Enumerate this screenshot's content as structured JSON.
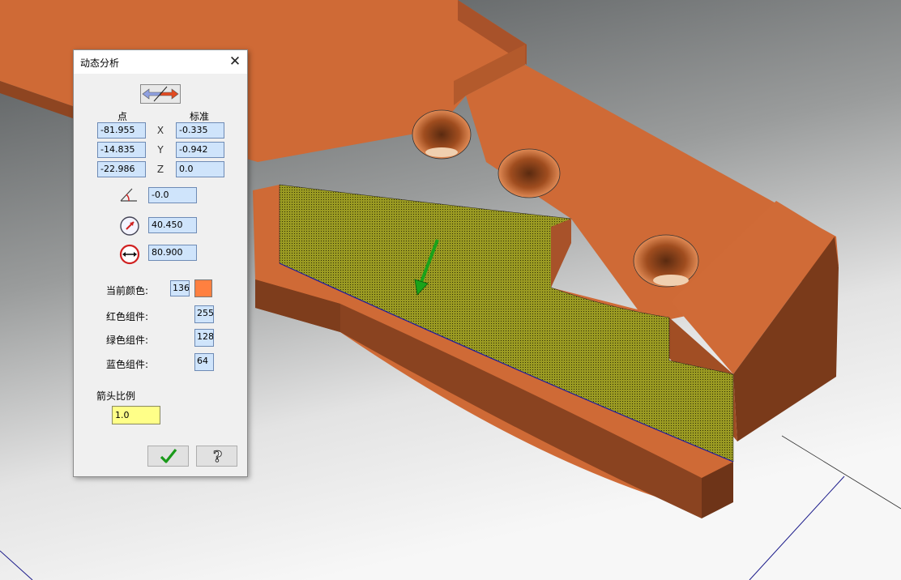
{
  "dialog": {
    "title": "动态分析",
    "point_header": "点",
    "normal_header": "标准",
    "point": {
      "x": "-81.955",
      "y": "-14.835",
      "z": "-22.986"
    },
    "normal": {
      "x": "-0.335",
      "y": "-0.942",
      "z": "0.0"
    },
    "axis_labels": {
      "x": "X",
      "y": "Y",
      "z": "Z"
    },
    "angle_value": "-0.0",
    "radius_value": "40.450",
    "diameter_value": "80.900",
    "current_color_label": "当前颜色:",
    "current_color_index": "136",
    "current_color_hex": "#ff8040",
    "red_label": "红色组件:",
    "red_value": "255",
    "green_label": "绿色组件:",
    "green_value": "128",
    "blue_label": "蓝色组件:",
    "blue_value": "64",
    "arrow_scale_label": "箭头比例",
    "arrow_scale_value": "1.0",
    "icons": {
      "direction": "double-arrow-icon",
      "angle": "angle-icon",
      "radius": "radius-gauge-icon",
      "diameter": "diameter-icon",
      "ok": "check-icon",
      "help": "help-question-icon",
      "close": "close-icon"
    }
  },
  "viewport": {
    "part_color": "#cc6633",
    "highlight_face_color": "#8f8f1f",
    "normal_arrow_color": "#1aa31a"
  }
}
